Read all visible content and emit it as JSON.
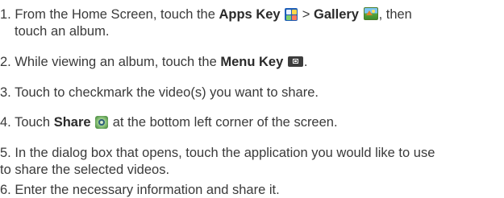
{
  "steps": [
    {
      "num": "1.",
      "a": "From the Home Screen, touch the",
      "b": "Apps Key",
      "c": ">",
      "d": "Gallery",
      "e": ", then",
      "f": "touch an album."
    },
    {
      "num": "2.",
      "a": "While viewing an album, touch the",
      "b": "Menu Key",
      "c": "."
    },
    {
      "num": "3.",
      "a": "Touch to checkmark the video(s) you want to share."
    },
    {
      "num": "4.",
      "a": "Touch",
      "b": "Share",
      "c": "at the bottom left corner of the screen."
    },
    {
      "num": "5.",
      "a": "In the dialog box that opens, touch the application you would like to use",
      "b": "to share the selected videos."
    },
    {
      "num": "6.",
      "a": "Enter the necessary information and share it."
    }
  ],
  "icons": {
    "apps": "apps-key-icon",
    "gallery": "gallery-icon",
    "menu": "menu-key-icon",
    "share": "share-icon"
  },
  "colors": {
    "text": "#3a3a3a",
    "apps_blue": "#1f5fb8",
    "gallery_sky": "#7cc6f5",
    "menu_dark": "#3d3d3d",
    "share_green": "#5f9e52"
  }
}
